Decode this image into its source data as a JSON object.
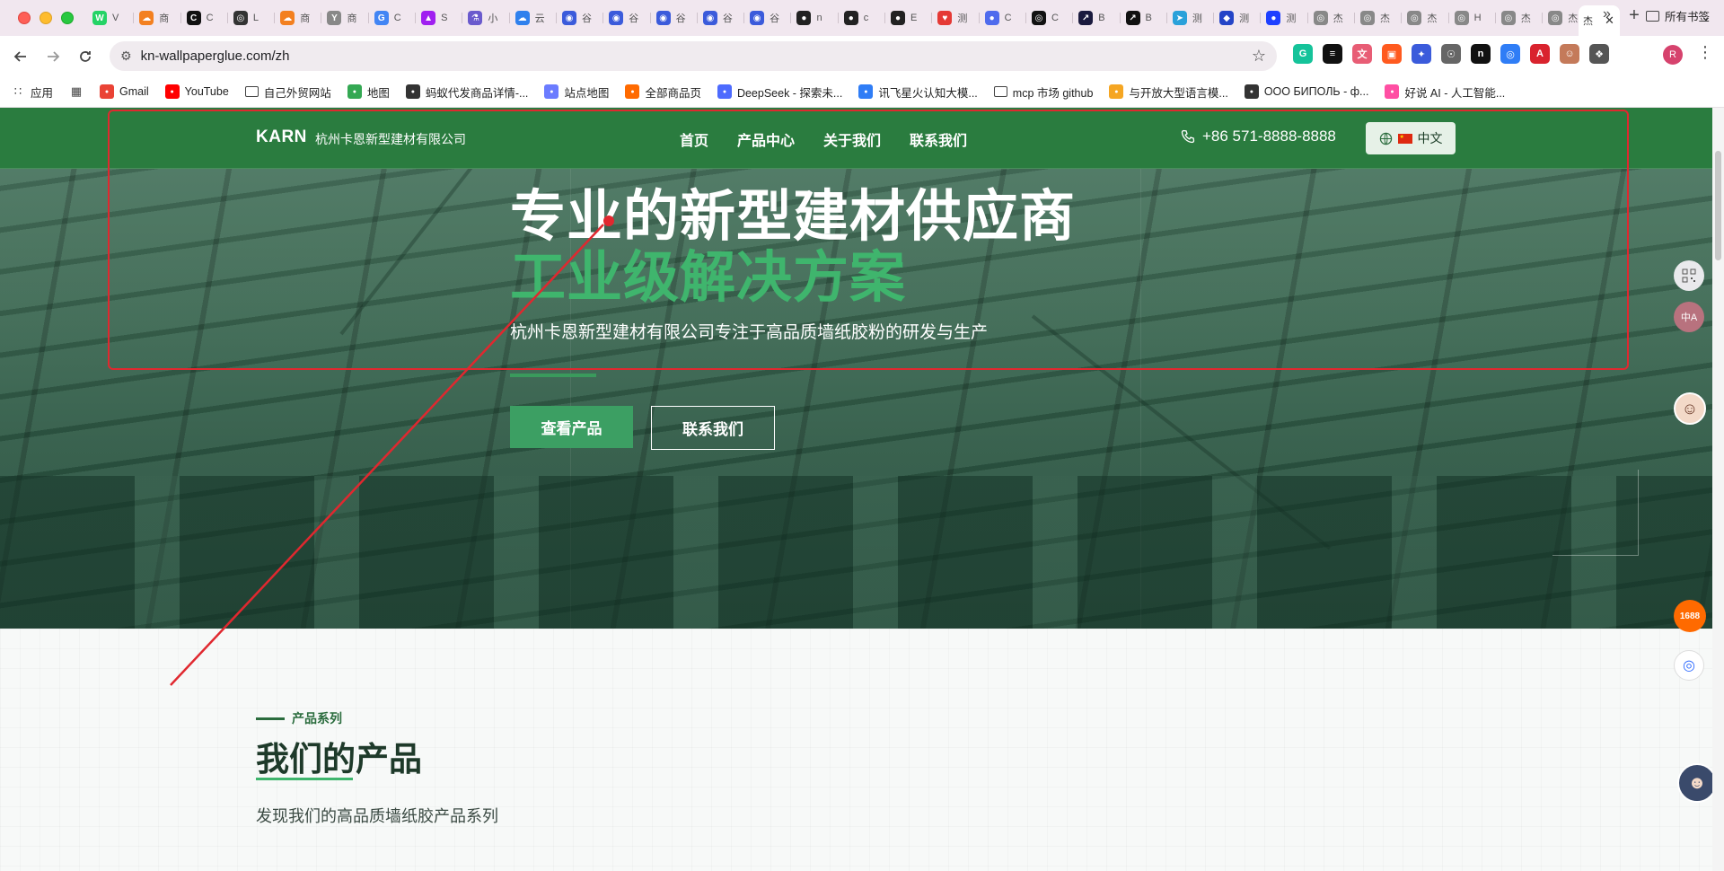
{
  "browser": {
    "tabs": [
      {
        "label": "V",
        "fav": "W",
        "color": "#25d366"
      },
      {
        "label": "商",
        "fav": "☁",
        "color": "#f38020"
      },
      {
        "label": "C",
        "fav": "C",
        "color": "#111111"
      },
      {
        "label": "L",
        "fav": "◎",
        "color": "#333333"
      },
      {
        "label": "商",
        "fav": "☁",
        "color": "#f38020"
      },
      {
        "label": "商",
        "fav": "Y",
        "color": "#888888"
      },
      {
        "label": "C",
        "fav": "G",
        "color": "#4285f4"
      },
      {
        "label": "S",
        "fav": "▲",
        "color": "#a020f0"
      },
      {
        "label": "小",
        "fav": "⚗",
        "color": "#6a5acd"
      },
      {
        "label": "云",
        "fav": "☁",
        "color": "#2f80ed"
      },
      {
        "label": "谷",
        "fav": "◉",
        "color": "#3b5bdb"
      },
      {
        "label": "谷",
        "fav": "◉",
        "color": "#3b5bdb"
      },
      {
        "label": "谷",
        "fav": "◉",
        "color": "#3b5bdb"
      },
      {
        "label": "谷",
        "fav": "◉",
        "color": "#3b5bdb"
      },
      {
        "label": "谷",
        "fav": "◉",
        "color": "#3b5bdb"
      },
      {
        "label": "n",
        "fav": "●",
        "color": "#222222"
      },
      {
        "label": "c",
        "fav": "●",
        "color": "#222222"
      },
      {
        "label": "E",
        "fav": "●",
        "color": "#222222"
      },
      {
        "label": "测",
        "fav": "♥",
        "color": "#e53935"
      },
      {
        "label": "C",
        "fav": "●",
        "color": "#4f6bed"
      },
      {
        "label": "C",
        "fav": "◎",
        "color": "#111111"
      },
      {
        "label": "B",
        "fav": "↗",
        "color": "#1a1a3e"
      },
      {
        "label": "B",
        "fav": "↗",
        "color": "#111111"
      },
      {
        "label": "测",
        "fav": "➤",
        "color": "#2aa1da"
      },
      {
        "label": "测",
        "fav": "◆",
        "color": "#2444c7"
      },
      {
        "label": "测",
        "fav": "●",
        "color": "#1e40ff"
      },
      {
        "label": "杰",
        "fav": "◎",
        "color": "#888888"
      },
      {
        "label": "杰",
        "fav": "◎",
        "color": "#888888"
      },
      {
        "label": "杰",
        "fav": "◎",
        "color": "#888888"
      },
      {
        "label": "H",
        "fav": "◎",
        "color": "#888888"
      },
      {
        "label": "杰",
        "fav": "◎",
        "color": "#888888"
      },
      {
        "label": "杰",
        "fav": "◎",
        "color": "#888888"
      }
    ],
    "active_tab": {
      "label": "杰"
    },
    "url": "kn-wallpaperglue.com/zh",
    "profile_initial": "R",
    "bookmarks": [
      {
        "label": "应用",
        "icon": "apps-icon",
        "type": "grid"
      },
      {
        "label": "",
        "icon": "grid-icon",
        "type": "grid2"
      },
      {
        "label": "Gmail",
        "icon": "gmail-icon",
        "color": "#ea4335"
      },
      {
        "label": "YouTube",
        "icon": "youtube-icon",
        "color": "#ff0000"
      },
      {
        "label": "自己外贸网站",
        "icon": "folder-icon",
        "type": "folder"
      },
      {
        "label": "地图",
        "icon": "maps-icon",
        "color": "#34a853"
      },
      {
        "label": "蚂蚁代发商品详情-...",
        "icon": "globe-icon",
        "color": "#333333"
      },
      {
        "label": "站点地图",
        "icon": "sitemap-icon",
        "color": "#6b7cff"
      },
      {
        "label": "全部商品页",
        "icon": "store-icon",
        "color": "#ff6a00"
      },
      {
        "label": "DeepSeek - 探索未...",
        "icon": "deepseek-icon",
        "color": "#4d6bfe"
      },
      {
        "label": "讯飞星火认知大模...",
        "icon": "spark-icon",
        "color": "#2f7df6"
      },
      {
        "label": "mcp 市场 github",
        "icon": "folder-icon",
        "type": "folder"
      },
      {
        "label": "与开放大型语言模...",
        "icon": "chat-icon",
        "color": "#f5a623"
      },
      {
        "label": "ООО БИПОЛЬ - ф...",
        "icon": "globe-icon",
        "color": "#333333"
      },
      {
        "label": "好说 AI - 人工智能...",
        "icon": "haoshuo-icon",
        "color": "#ff4fa3"
      }
    ],
    "bookmarks_all": "所有书签",
    "extensions": [
      {
        "name": "grammarly-icon",
        "color": "#15c39a",
        "g": "G"
      },
      {
        "name": "layers-icon",
        "color": "#111111",
        "g": "≡"
      },
      {
        "name": "translate-icon",
        "color": "#e85d75",
        "g": "文"
      },
      {
        "name": "ext-orange-icon",
        "color": "#ff5a1f",
        "g": "▣"
      },
      {
        "name": "ext-blue-icon",
        "color": "#3b5bdb",
        "g": "✦"
      },
      {
        "name": "robot-icon",
        "color": "#666666",
        "g": "☉"
      },
      {
        "name": "ext-black-icon",
        "color": "#111111",
        "g": "n"
      },
      {
        "name": "ext-blue2-icon",
        "color": "#2f7df6",
        "g": "◎"
      },
      {
        "name": "acrobat-icon",
        "color": "#d9232e",
        "g": "A"
      },
      {
        "name": "avatar-ext-icon",
        "color": "#c47a5a",
        "g": "☺"
      },
      {
        "name": "puzzle-icon",
        "color": "#555555",
        "g": "❖"
      }
    ]
  },
  "site": {
    "logo": "KARN",
    "company": "杭州卡恩新型建材有限公司",
    "nav": [
      "首页",
      "产品中心",
      "关于我们",
      "联系我们"
    ],
    "phone": "+86 571-8888-8888",
    "language": "中文",
    "hero": {
      "title_line1": "专业的新型建材供应商",
      "title_line2": "工业级解决方案",
      "subtitle": "杭州卡恩新型建材有限公司专注于高品质墙纸胶粉的研发与生产",
      "primary_button": "查看产品",
      "secondary_button": "联系我们"
    },
    "products": {
      "tag": "产品系列",
      "title": "我们的产品",
      "description": "发现我们的高品质墙纸胶产品系列"
    }
  },
  "colors": {
    "nav_green": "#2a7c3f",
    "accent_green": "#3fb56d",
    "annotation_red": "#e0282f"
  }
}
